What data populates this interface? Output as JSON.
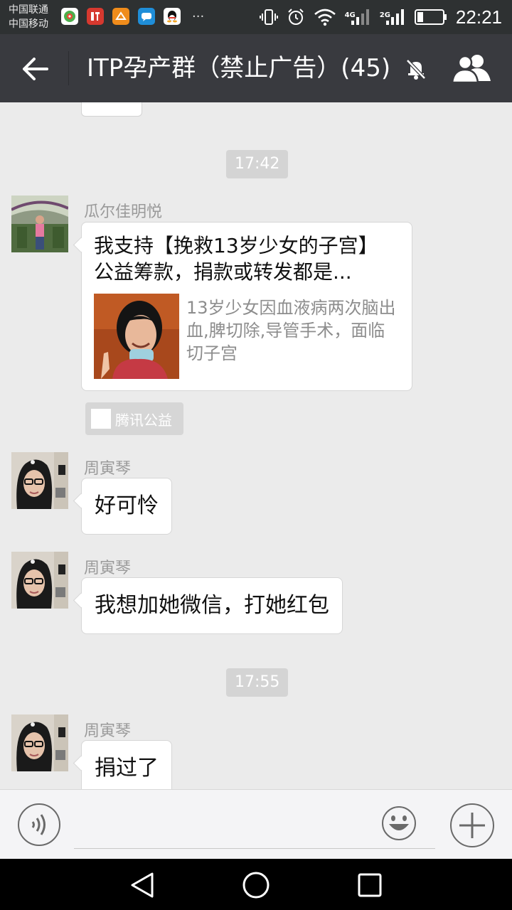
{
  "status_bar": {
    "carrier_1": "中国联通",
    "carrier_2": "中国移动",
    "overflow": "···",
    "net_1": "4G",
    "net_2": "2G",
    "time": "22:21"
  },
  "header": {
    "title": "ITP孕产群（禁止广告）(45)"
  },
  "chat": {
    "timestamps": [
      "17:42",
      "17:55"
    ],
    "messages": [
      {
        "sender": "瓜尔佳明悦",
        "card": {
          "title_line_1": "我支持【挽救13岁少女的子宫】",
          "title_line_2": "公益筹款，捐款或转发都是...",
          "description": "13岁少女因血液病两次脑出血,脾切除,导管手术，面临切子宫"
        },
        "source": "腾讯公益"
      },
      {
        "sender": "周寅琴",
        "text": "好可怜"
      },
      {
        "sender": "周寅琴",
        "text": "我想加她微信，打她红包"
      },
      {
        "sender": "周寅琴",
        "text": "捐过了"
      }
    ]
  },
  "input_bar": {
    "placeholder": ""
  },
  "colors": {
    "status_bar_bg": "#2e3132",
    "title_bar_bg": "#393a3f",
    "chat_bg": "#ebebeb",
    "timestamp_bg": "#d4d4d4",
    "nav_bar_bg": "#000000"
  },
  "icons": {
    "status_apps": [
      "qihoo-icon",
      "ting-icon",
      "taobao-icon",
      "message-icon",
      "qq-icon"
    ],
    "status_system": [
      "vibrate-icon",
      "alarm-icon",
      "wifi-icon",
      "signal-icon",
      "signal-icon",
      "battery-icon"
    ],
    "header": [
      "back-arrow-icon",
      "mute-bell-icon",
      "group-members-icon"
    ],
    "input": [
      "voice-icon",
      "emoji-icon",
      "plus-icon"
    ],
    "nav": [
      "nav-back-icon",
      "nav-home-icon",
      "nav-recent-icon"
    ]
  }
}
